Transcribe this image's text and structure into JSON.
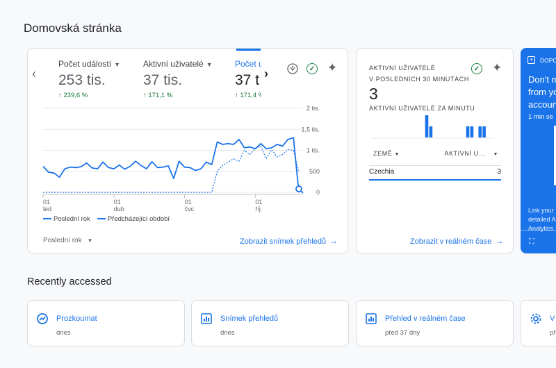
{
  "page": {
    "title": "Domovská stránka"
  },
  "overview": {
    "metrics": [
      {
        "label": "Počet událostí",
        "value": "253 tis.",
        "change": "239,6 %"
      },
      {
        "label": "Aktivní uživatelé",
        "value": "37 tis.",
        "change": "171,1 %"
      },
      {
        "label": "Počet u",
        "value": "37 t",
        "change": "171,4 %"
      }
    ],
    "legend": {
      "current": "Poslední rok",
      "previous": "Předcházející období"
    },
    "period": "Poslední rok",
    "link": "Zobrazit snímek přehledů"
  },
  "chart_data": {
    "type": "line",
    "y_ticks": [
      "2 tis.",
      "1,5 tis.",
      "1 tis.",
      "500",
      "0"
    ],
    "y_tick_values": [
      2000,
      1500,
      1000,
      500,
      0
    ],
    "ylim": [
      0,
      2000
    ],
    "x_ticks": [
      {
        "day": "01",
        "month": "led",
        "index": 0
      },
      {
        "day": "01",
        "month": "dub",
        "index": 13
      },
      {
        "day": "01",
        "month": "čvc",
        "index": 26
      },
      {
        "day": "01",
        "month": "říj",
        "index": 39
      }
    ],
    "series": [
      {
        "name": "Poslední rok",
        "style": "solid",
        "values": [
          620,
          480,
          460,
          360,
          560,
          600,
          590,
          610,
          700,
          580,
          560,
          720,
          590,
          560,
          650,
          550,
          620,
          740,
          640,
          560,
          730,
          590,
          600,
          630,
          330,
          740,
          600,
          590,
          520,
          560,
          720,
          660,
          1200,
          1140,
          1160,
          1140,
          1260,
          1060,
          1080,
          1040,
          1160,
          1040,
          1060,
          1140,
          1100,
          1260,
          1300,
          0
        ]
      },
      {
        "name": "Předcházející období",
        "style": "dashed",
        "values": [
          0,
          0,
          0,
          0,
          0,
          0,
          0,
          0,
          0,
          0,
          0,
          0,
          0,
          0,
          0,
          0,
          0,
          0,
          0,
          0,
          0,
          0,
          0,
          0,
          0,
          0,
          0,
          0,
          0,
          0,
          0,
          0,
          500,
          640,
          720,
          800,
          740,
          1000,
          900,
          1040,
          1100,
          800,
          1020,
          840,
          900,
          1020,
          1000,
          480
        ]
      }
    ]
  },
  "realtime": {
    "heading_line1": "AKTIVNÍ UŽIVATELÉ",
    "heading_line2": "V POSLEDNÍCH 30 MINUTÁCH",
    "value": "3",
    "per_minute_label": "AKTIVNÍ UŽIVATELÉ ZA MINUTU",
    "per_minute": [
      0,
      0,
      0,
      0,
      0,
      0,
      0,
      0,
      0,
      0,
      0,
      0,
      0,
      2,
      1,
      0,
      0,
      0,
      0,
      0,
      0,
      0,
      0,
      1,
      1,
      0,
      1,
      1,
      0,
      0
    ],
    "col_country": "ZEMĚ",
    "col_users": "AKTIVNÍ U…",
    "rows": [
      {
        "country": "Czechia",
        "users": "3"
      }
    ],
    "link": "Zobrazit v reálném čase"
  },
  "promo": {
    "title": "DOPO",
    "text_lines": [
      "Don't m",
      "from yo",
      "accoun"
    ],
    "time": "1 min se",
    "footer_lines": [
      "Link your",
      "detailed A",
      "Analytics"
    ]
  },
  "recent": {
    "title": "Recently accessed",
    "items": [
      {
        "title": "Prozkoumat",
        "date": "dnes",
        "icon": "explore-icon"
      },
      {
        "title": "Snímek přehledů",
        "date": "dnes",
        "icon": "reports-icon"
      },
      {
        "title": "Přehled v reálném čase",
        "date": "před 37 dny",
        "icon": "realtime-icon"
      },
      {
        "title": "V",
        "date": "př",
        "icon": "gear-icon"
      }
    ]
  },
  "colors": {
    "accent": "#1a73e8",
    "positive": "#137333",
    "check": "#188038"
  }
}
